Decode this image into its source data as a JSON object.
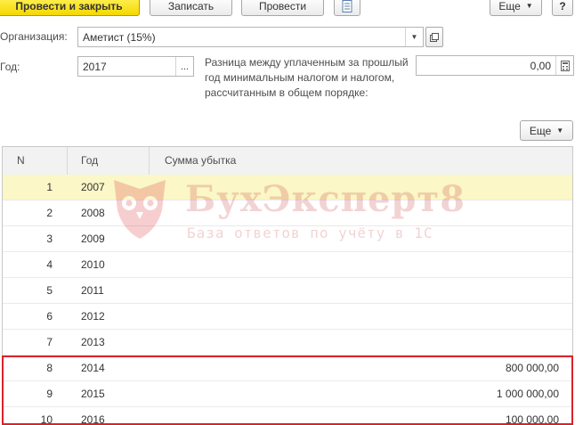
{
  "toolbar": {
    "post_close_label": "Провести и закрыть",
    "save_label": "Записать",
    "post_label": "Провести",
    "more_label": "Еще",
    "help_label": "?"
  },
  "form": {
    "org_label": "Организация:",
    "org_value": "Аметист (15%)",
    "year_label": "Год:",
    "year_value": "2017",
    "diff_note": "Разница между уплаченным за прошлый год минимальным налогом и налогом, рассчитанным в общем порядке:",
    "diff_value": "0,00"
  },
  "table": {
    "more_label": "Еще",
    "columns": {
      "n": "N",
      "year": "Год",
      "amount": "Сумма убытка"
    },
    "rows": [
      {
        "n": "1",
        "year": "2007",
        "amount": ""
      },
      {
        "n": "2",
        "year": "2008",
        "amount": ""
      },
      {
        "n": "3",
        "year": "2009",
        "amount": ""
      },
      {
        "n": "4",
        "year": "2010",
        "amount": ""
      },
      {
        "n": "5",
        "year": "2011",
        "amount": ""
      },
      {
        "n": "6",
        "year": "2012",
        "amount": ""
      },
      {
        "n": "7",
        "year": "2013",
        "amount": ""
      },
      {
        "n": "8",
        "year": "2014",
        "amount": "800 000,00"
      },
      {
        "n": "9",
        "year": "2015",
        "amount": "1 000 000,00"
      },
      {
        "n": "10",
        "year": "2016",
        "amount": "100 000,00"
      }
    ]
  },
  "watermark": {
    "brand": "БухЭксперт8",
    "tagline": "База ответов по учёту в 1С"
  },
  "colors": {
    "primary_button": "#f5d800",
    "selected_row": "#fbf7c7",
    "highlight_border": "#d9232a"
  }
}
